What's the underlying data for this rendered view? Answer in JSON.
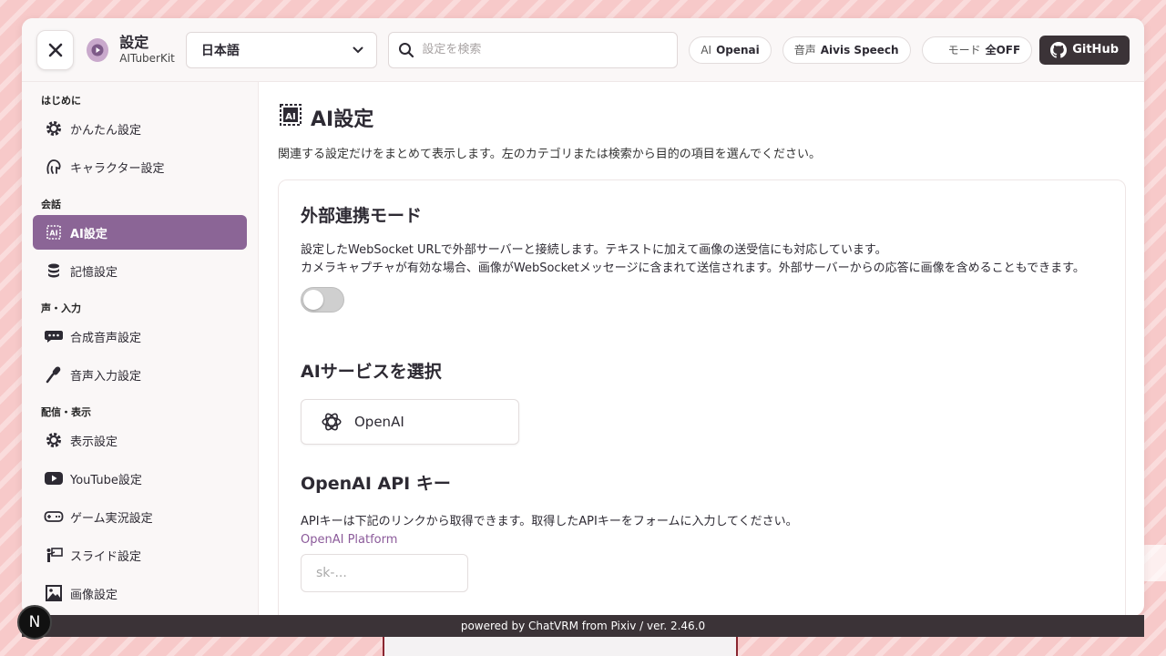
{
  "header": {
    "title": "設定",
    "subtitle": "AITuberKit",
    "language": "日本語",
    "search_placeholder": "設定を検索",
    "chips": [
      {
        "key": "AI",
        "value": "Openai"
      },
      {
        "key": "音声",
        "value": "Aivis Speech"
      },
      {
        "key": "モード",
        "value": "全OFF"
      }
    ],
    "github_label": "GitHub"
  },
  "sidebar": {
    "sections": [
      {
        "title": "はじめに",
        "items": [
          {
            "label": "かんたん設定",
            "icon": "gear-icon"
          },
          {
            "label": "キャラクター設定",
            "icon": "character-icon"
          }
        ]
      },
      {
        "title": "会話",
        "items": [
          {
            "label": "AI設定",
            "icon": "ai-chip-icon",
            "active": true
          },
          {
            "label": "記憶設定",
            "icon": "database-icon"
          }
        ]
      },
      {
        "title": "声・入力",
        "items": [
          {
            "label": "合成音声設定",
            "icon": "chat-bubble-icon"
          },
          {
            "label": "音声入力設定",
            "icon": "microphone-icon"
          }
        ]
      },
      {
        "title": "配信・表示",
        "items": [
          {
            "label": "表示設定",
            "icon": "gear-icon"
          },
          {
            "label": "YouTube設定",
            "icon": "youtube-icon"
          },
          {
            "label": "ゲーム実況設定",
            "icon": "gamepad-icon"
          },
          {
            "label": "スライド設定",
            "icon": "presentation-icon"
          },
          {
            "label": "画像設定",
            "icon": "image-icon"
          }
        ]
      }
    ]
  },
  "main": {
    "title": "AI設定",
    "description": "関連する設定だけをまとめて表示します。左のカテゴリまたは検索から目的の項目を選んでください。",
    "external": {
      "heading": "外部連携モード",
      "line1": "設定したWebSocket URLで外部サーバーと接続します。テキストに加えて画像の送受信にも対応しています。",
      "line2": "カメラキャプチャが有効な場合、画像がWebSocketメッセージに含まれて送信されます。外部サーバーからの応答に画像を含めることもできます。",
      "enabled": false
    },
    "service": {
      "heading": "AIサービスを選択",
      "selected": "OpenAI"
    },
    "api_key": {
      "heading": "OpenAI API キー",
      "description": "APIキーは下記のリンクから取得できます。取得したAPIキーをフォームに入力してください。",
      "link_label": "OpenAI Platform",
      "placeholder": "sk-..."
    }
  },
  "footer": {
    "text": "powered by ChatVRM from Pixiv / ver. 2.46.0"
  },
  "badge": {
    "letter": "N"
  },
  "colors": {
    "accent": "#8b6596",
    "footer": "#3b3337",
    "background": "#f7c9c9"
  }
}
